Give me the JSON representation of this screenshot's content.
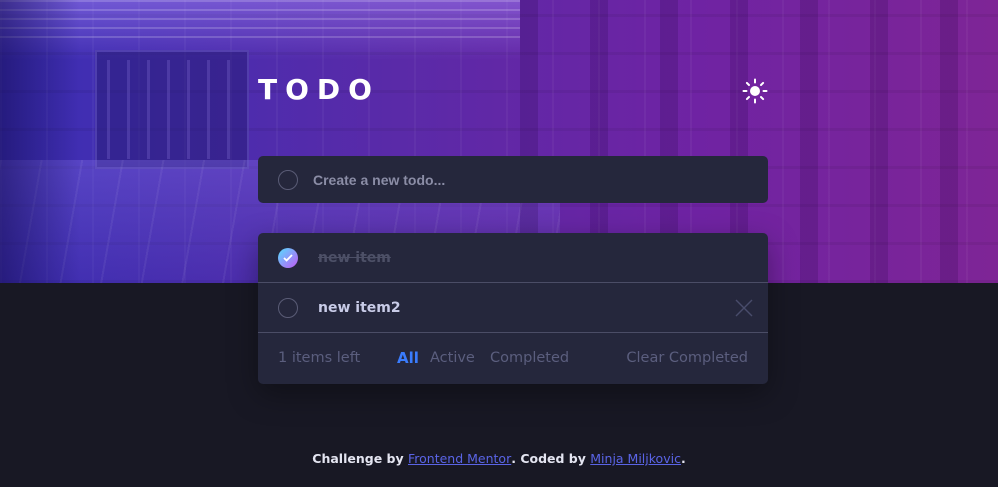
{
  "header": {
    "title": "TODO",
    "theme_icon": "sun-icon"
  },
  "new_todo": {
    "placeholder": "Create a new todo...",
    "value": ""
  },
  "todos": [
    {
      "text": "new item",
      "completed": true
    },
    {
      "text": "new item2",
      "completed": false
    }
  ],
  "footer": {
    "items_left": "1 items left",
    "filters": {
      "all": "All",
      "active": "Active",
      "completed": "Completed"
    },
    "selected_filter": "All",
    "clear_completed": "Clear Completed"
  },
  "attribution": {
    "prefix": "Challenge by ",
    "link1": "Frontend Mentor",
    "middle": ". Coded by ",
    "link2": "Minja Miljkovic",
    "suffix": "."
  },
  "colors": {
    "accent": "#3a7cfd",
    "background": "#181824",
    "card": "#25273c",
    "check_gradient_start": "#57ddff",
    "check_gradient_end": "#c058f3"
  }
}
